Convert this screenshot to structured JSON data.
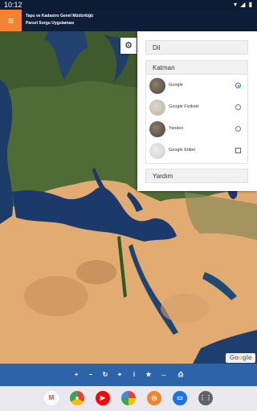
{
  "status_bar": {
    "time": "10:12"
  },
  "header": {
    "title_line1": "Tapu ve Kadastro Genel Müdürlüğü",
    "title_line2": "Parsel Sorgu Uygulaması"
  },
  "panel": {
    "language_label": "Dil",
    "layer_label": "Katman",
    "help_label": "Yardım",
    "layers": [
      {
        "label": "Google",
        "control": "radio",
        "selected": true
      },
      {
        "label": "Google Fiziksel",
        "control": "radio",
        "selected": false
      },
      {
        "label": "Yandex",
        "control": "radio",
        "selected": false
      },
      {
        "label": "Google Etiket",
        "control": "checkbox",
        "selected": false
      }
    ]
  },
  "map": {
    "attribution": "Google"
  },
  "toolbar": {
    "icons": [
      "zoom-in",
      "zoom-out",
      "refresh",
      "locate",
      "info",
      "favorite",
      "measure",
      "print"
    ]
  },
  "dock": {
    "apps": [
      "Gmail",
      "Chrome",
      "YouTube",
      "Photos",
      "Unknown app",
      "Messages",
      "Apps"
    ]
  },
  "colors": {
    "accent_orange": "#f5822f",
    "toolbar_blue": "#2d63a8",
    "header_navy": "#0e1d38"
  }
}
